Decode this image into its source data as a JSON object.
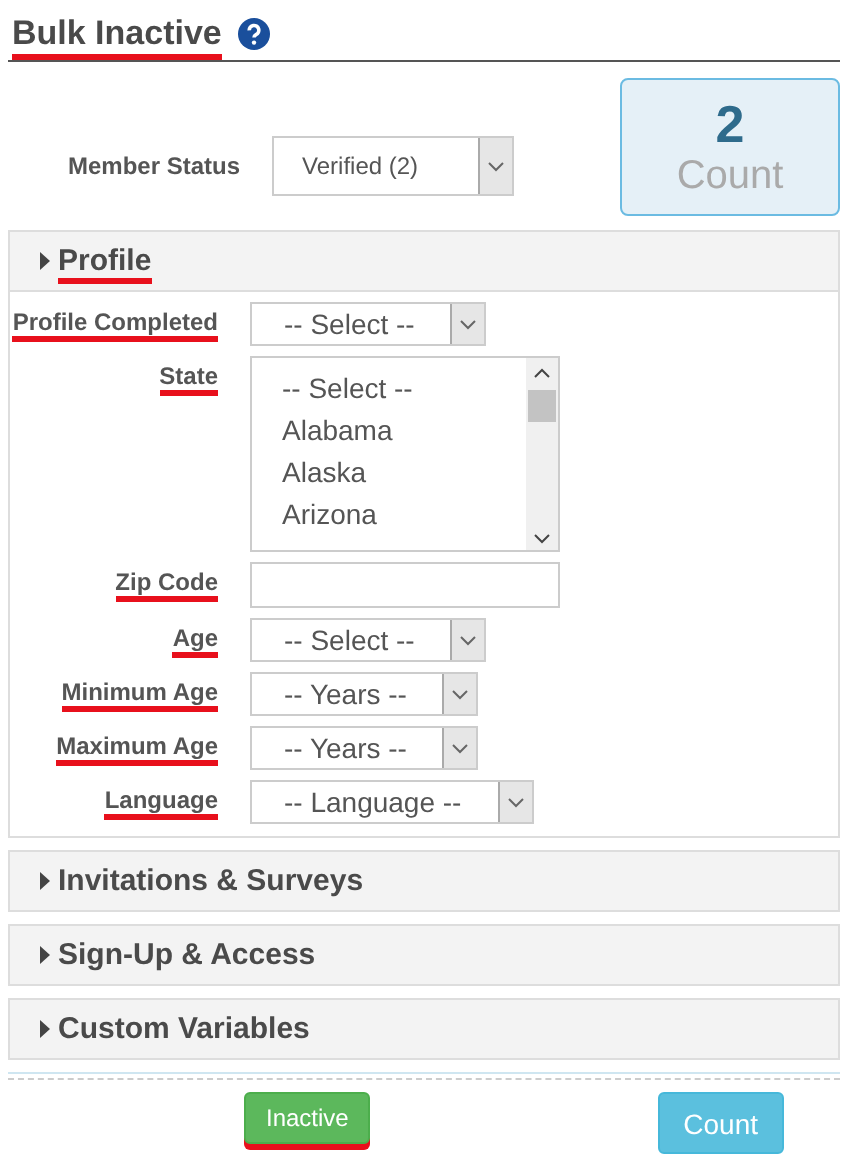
{
  "page": {
    "title": "Bulk Inactive",
    "title_underlined": true
  },
  "member_status": {
    "label": "Member Status",
    "value": "Verified (2)"
  },
  "count_box": {
    "number": "2",
    "label": "Count"
  },
  "sections": [
    {
      "title": "Profile",
      "expanded": true,
      "underlined": true,
      "fields": [
        {
          "kind": "select",
          "label": "Profile Completed",
          "value": "-- Select --",
          "underlined": true
        },
        {
          "kind": "listbox",
          "label": "State",
          "options": [
            "-- Select --",
            "Alabama",
            "Alaska",
            "Arizona"
          ],
          "underlined": true
        },
        {
          "kind": "text",
          "label": "Zip Code",
          "underlined": true
        },
        {
          "kind": "select",
          "label": "Age",
          "value": "-- Select --",
          "underlined": true
        },
        {
          "kind": "select",
          "label": "Minimum Age",
          "value": "-- Years --",
          "underlined": true
        },
        {
          "kind": "select",
          "label": "Maximum Age",
          "value": "-- Years --",
          "underlined": true
        },
        {
          "kind": "select",
          "label": "Language",
          "value": "-- Language --",
          "underlined": true
        }
      ]
    },
    {
      "title": "Invitations & Surveys",
      "expanded": false,
      "underlined": false
    },
    {
      "title": "Sign-Up & Access",
      "expanded": false,
      "underlined": false
    },
    {
      "title": "Custom Variables",
      "expanded": false,
      "underlined": false
    }
  ],
  "buttons": [
    {
      "label": "Inactive",
      "kind": "success",
      "underlined": true
    },
    {
      "label": "Count",
      "kind": "info",
      "underlined": false
    }
  ]
}
